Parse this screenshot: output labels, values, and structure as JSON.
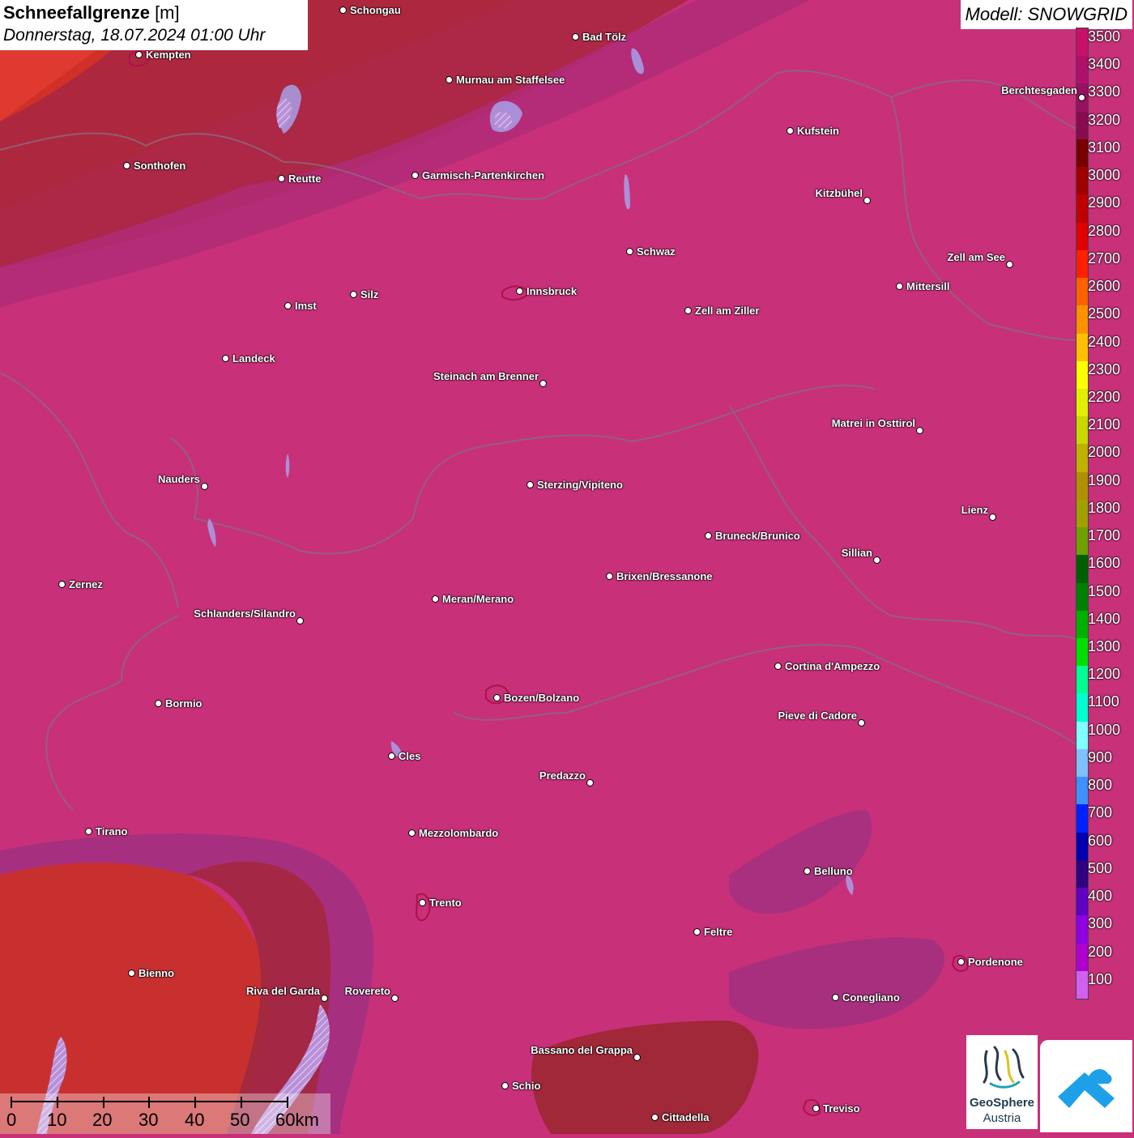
{
  "title": {
    "main_bold": "Schneefallgrenze",
    "main_unit": " [m]",
    "subtitle": "Donnerstag, 18.07.2024 01:00 Uhr"
  },
  "model": "Modell: SNOWGRID",
  "legend": {
    "unit": "m",
    "levels": [
      {
        "value": "3500",
        "color": "#c8106a"
      },
      {
        "value": "3400",
        "color": "#b0106a"
      },
      {
        "value": "3300",
        "color": "#9a1060"
      },
      {
        "value": "3200",
        "color": "#8a0a50"
      },
      {
        "value": "3100",
        "color": "#7a0000"
      },
      {
        "value": "3000",
        "color": "#a00000"
      },
      {
        "value": "2900",
        "color": "#c00000"
      },
      {
        "value": "2800",
        "color": "#e00000"
      },
      {
        "value": "2700",
        "color": "#ff2000"
      },
      {
        "value": "2600",
        "color": "#ff6000"
      },
      {
        "value": "2500",
        "color": "#ff9000"
      },
      {
        "value": "2400",
        "color": "#ffc000"
      },
      {
        "value": "2300",
        "color": "#ffff00"
      },
      {
        "value": "2200",
        "color": "#e0f000"
      },
      {
        "value": "2100",
        "color": "#c8d800"
      },
      {
        "value": "2000",
        "color": "#c0b000"
      },
      {
        "value": "1900",
        "color": "#b09000"
      },
      {
        "value": "1800",
        "color": "#a0a000"
      },
      {
        "value": "1700",
        "color": "#70a000"
      },
      {
        "value": "1600",
        "color": "#006000"
      },
      {
        "value": "1500",
        "color": "#008000"
      },
      {
        "value": "1400",
        "color": "#00b000"
      },
      {
        "value": "1300",
        "color": "#00e000"
      },
      {
        "value": "1200",
        "color": "#00ff90"
      },
      {
        "value": "1100",
        "color": "#00ffd0"
      },
      {
        "value": "1000",
        "color": "#80ffff"
      },
      {
        "value": "900",
        "color": "#80c0ff"
      },
      {
        "value": "800",
        "color": "#4090ff"
      },
      {
        "value": "700",
        "color": "#0020ff"
      },
      {
        "value": "600",
        "color": "#0000b0"
      },
      {
        "value": "500",
        "color": "#300080"
      },
      {
        "value": "400",
        "color": "#6000c0"
      },
      {
        "value": "300",
        "color": "#9000e0"
      },
      {
        "value": "200",
        "color": "#b000d0"
      },
      {
        "value": "100",
        "color": "#d060f0"
      }
    ]
  },
  "scalebar": {
    "labels": [
      "0",
      "10",
      "20",
      "30",
      "40",
      "50",
      "60km"
    ]
  },
  "logos": {
    "geosphere_line1": "GeoSphere",
    "geosphere_line2": "Austria"
  },
  "cities": [
    {
      "name": "Schongau"
    },
    {
      "name": "Bad Tölz"
    },
    {
      "name": "Kempten"
    },
    {
      "name": "Murnau am Staffelsee"
    },
    {
      "name": "Kufstein"
    },
    {
      "name": "Berchtesgaden"
    },
    {
      "name": "Sonthofen"
    },
    {
      "name": "Reutte"
    },
    {
      "name": "Garmisch-Partenkirchen"
    },
    {
      "name": "Kitzbühel"
    },
    {
      "name": "Schwaz"
    },
    {
      "name": "Zell am See"
    },
    {
      "name": "Silz"
    },
    {
      "name": "Imst"
    },
    {
      "name": "Innsbruck"
    },
    {
      "name": "Mittersill"
    },
    {
      "name": "Zell am Ziller"
    },
    {
      "name": "Landeck"
    },
    {
      "name": "Steinach am Brenner"
    },
    {
      "name": "Matrei in Osttirol"
    },
    {
      "name": "Nauders"
    },
    {
      "name": "Sterzing/Vipiteno"
    },
    {
      "name": "Lienz"
    },
    {
      "name": "Bruneck/Brunico"
    },
    {
      "name": "Sillian"
    },
    {
      "name": "Zernez"
    },
    {
      "name": "Brixen/Bressanone"
    },
    {
      "name": "Meran/Merano"
    },
    {
      "name": "Schlanders/Silandro"
    },
    {
      "name": "Cortina d'Ampezzo"
    },
    {
      "name": "Bozen/Bolzano"
    },
    {
      "name": "Bormio"
    },
    {
      "name": "Pieve di Cadore"
    },
    {
      "name": "Cles"
    },
    {
      "name": "Predazzo"
    },
    {
      "name": "Tirano"
    },
    {
      "name": "Mezzolombardo"
    },
    {
      "name": "Belluno"
    },
    {
      "name": "Trento"
    },
    {
      "name": "Feltre"
    },
    {
      "name": "Bienno"
    },
    {
      "name": "Pordenone"
    },
    {
      "name": "Riva del Garda"
    },
    {
      "name": "Rovereto"
    },
    {
      "name": "Conegliano"
    },
    {
      "name": "Bassano del Grappa"
    },
    {
      "name": "Schio"
    },
    {
      "name": "Treviso"
    },
    {
      "name": "Cittadella"
    }
  ]
}
